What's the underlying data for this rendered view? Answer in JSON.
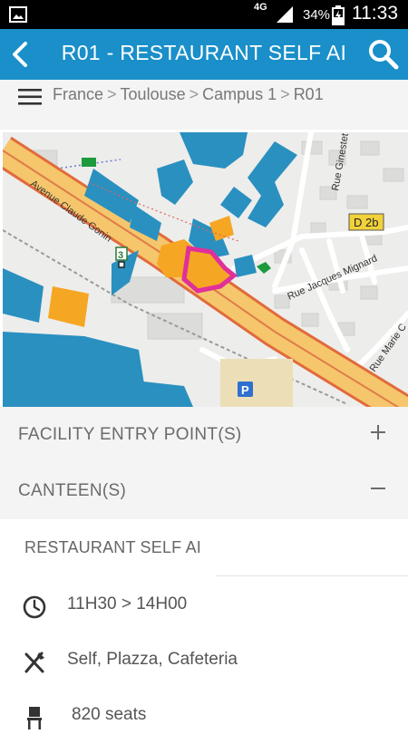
{
  "status_bar": {
    "network": "4G",
    "battery": "34%",
    "time": "11:33"
  },
  "app_bar": {
    "title": "R01 - RESTAURANT SELF AI"
  },
  "breadcrumb": [
    "France",
    "Toulouse",
    "Campus 1",
    "R01"
  ],
  "map": {
    "street_labels": [
      "Avenue Claude Gonin",
      "Rue Ginestet",
      "Rue Jacques Mignard",
      "Rue Marie C"
    ],
    "badges": [
      "D 2b",
      "3",
      "P"
    ],
    "colors": {
      "building": "#2a90c0",
      "highlight_orange": "#f5a623",
      "selection": "#e0309a",
      "road": "#f0c060",
      "green": "#1d9a3c"
    }
  },
  "sections": [
    {
      "label": "FACILITY ENTRY POINT(S)",
      "toggle": "+"
    },
    {
      "label": "CANTEEN(S)",
      "toggle": "−"
    }
  ],
  "canteen": {
    "name": "RESTAURANT SELF AI",
    "hours": "11H30 > 14H00",
    "types": "Self, Plazza, Cafeteria",
    "seats": "820 seats"
  },
  "icons": [
    "gallery-icon",
    "signal-icon",
    "battery-icon",
    "back-arrow-icon",
    "search-icon",
    "menu-icon",
    "plus-icon",
    "minus-icon",
    "clock-icon",
    "utensils-icon",
    "chair-icon"
  ]
}
